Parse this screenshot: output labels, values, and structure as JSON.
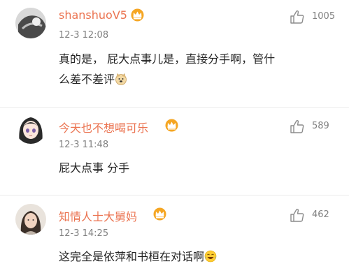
{
  "comments": [
    {
      "username": "shanshuoV5",
      "time": "12-3 12:08",
      "text_line1": "真的是， 屁大点事儿是，直接分手啊，管什",
      "text_line2": "么差不差评",
      "emoji": "doge-emoji",
      "likes": "1005"
    },
    {
      "username": "今天也不想喝可乐",
      "time": "12-3 11:48",
      "text_line1": "屁大点事 分手",
      "likes": "589"
    },
    {
      "username": "知情人士大舅妈",
      "time": "12-3 14:25",
      "text_line1": "这完全是依萍和书桓在对话啊",
      "emoji": "laughing-tears-emoji",
      "likes": "462"
    }
  ],
  "colors": {
    "username": "#eb7350",
    "meta": "#808080",
    "text": "#222222",
    "crown": "#f5a623"
  }
}
